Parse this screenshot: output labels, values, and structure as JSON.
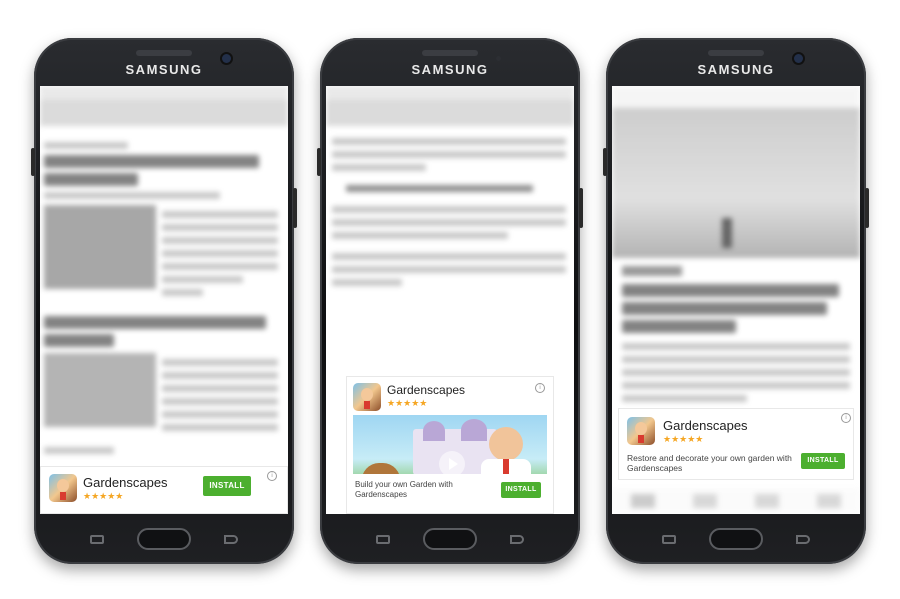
{
  "brand": "SAMSUNG",
  "colors": {
    "install_green": "#4caf2f",
    "star_orange": "#f5a623",
    "phone_black": "#0d0e10"
  },
  "ad": {
    "app_name": "Gardenscapes",
    "stars": "★★★★★",
    "rating": 4.5,
    "install_label": "INSTALL",
    "info_icon": "info-icon",
    "medium_body": "Build your own Garden with Gardenscapes",
    "large_body": "Restore and decorate your own garden with Gardenscapes"
  }
}
